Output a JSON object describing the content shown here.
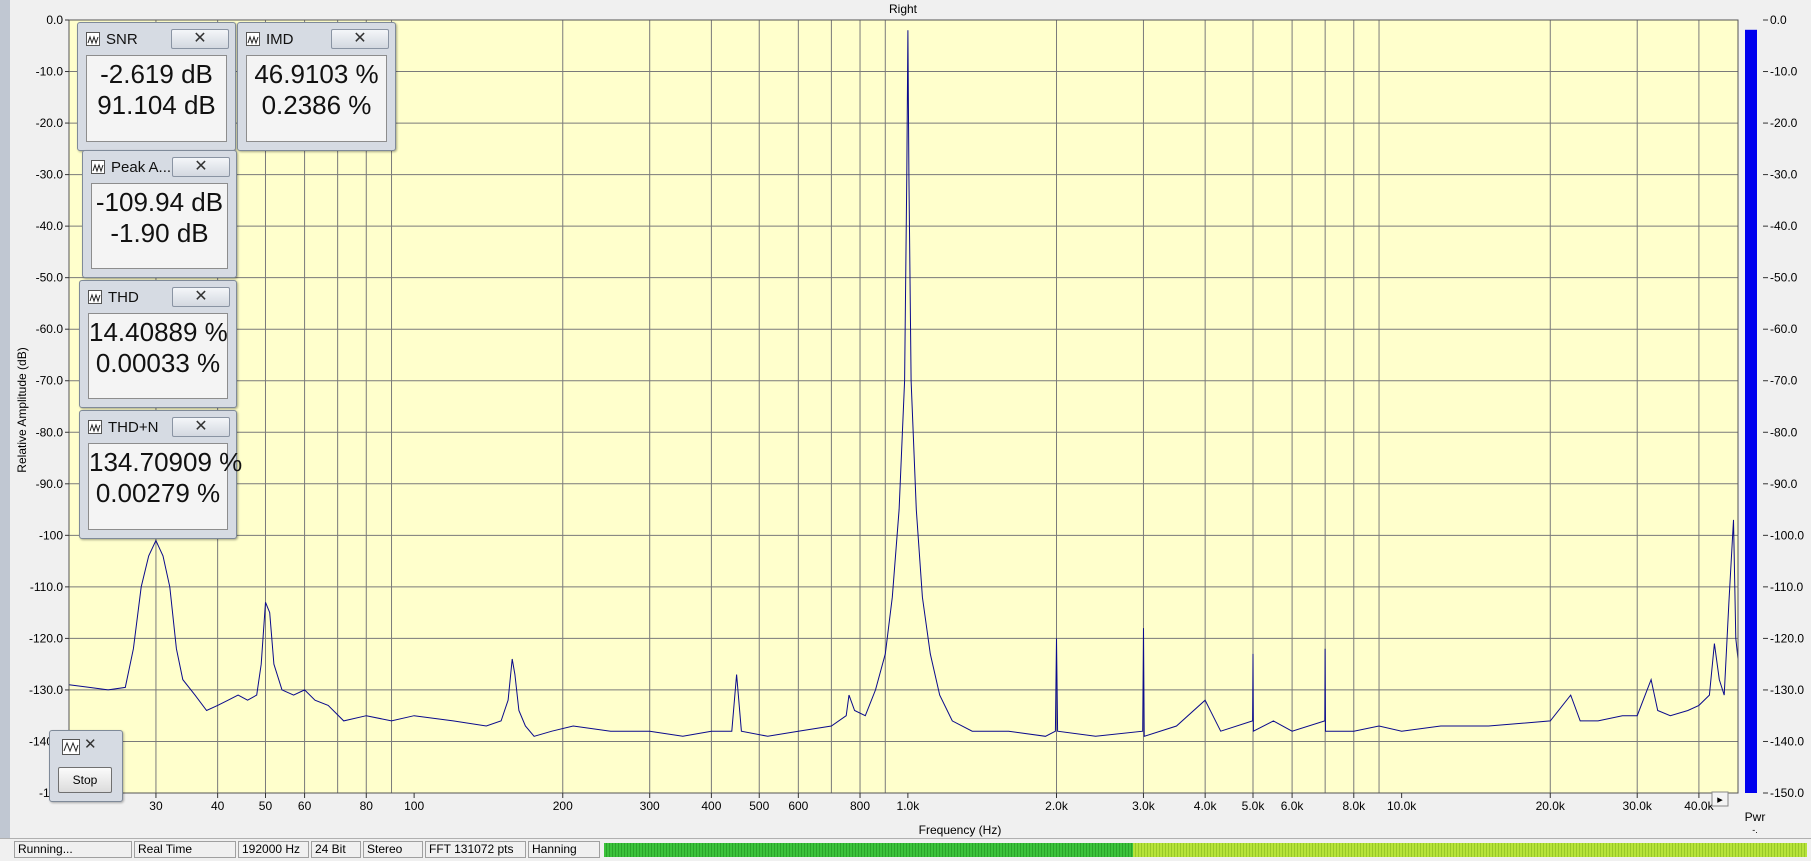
{
  "chart_data": {
    "type": "line",
    "title": "Right",
    "xlabel": "Frequency (Hz)",
    "ylabel": "Relative Amplitude (dB)",
    "x_scale": "log",
    "xlim": [
      20,
      48000
    ],
    "ylim": [
      -150,
      0
    ],
    "grid": true,
    "x_tick_labels": [
      "30",
      "40",
      "50",
      "60",
      "80",
      "100",
      "200",
      "300",
      "400",
      "500",
      "600",
      "800",
      "1.0k",
      "2.0k",
      "3.0k",
      "4.0k",
      "5.0k",
      "6.0k",
      "8.0k",
      "10.0k",
      "20.0k",
      "30.0k",
      "40.0k"
    ],
    "x_tick_values": [
      30,
      40,
      50,
      60,
      80,
      100,
      200,
      300,
      400,
      500,
      600,
      800,
      1000,
      2000,
      3000,
      4000,
      5000,
      6000,
      8000,
      10000,
      20000,
      30000,
      40000
    ],
    "y_tick_labels": [
      "0.0",
      "-10.0",
      "-20.0",
      "-30.0",
      "-40.0",
      "-50.0",
      "-60.0",
      "-70.0",
      "-80.0",
      "-90.0",
      "-100",
      "-110.0",
      "-120.0",
      "-130.0",
      "-140.0",
      "-150"
    ],
    "series": [
      {
        "color": "#0a0a8c",
        "points": [
          [
            20,
            -129
          ],
          [
            22,
            -129.5
          ],
          [
            24,
            -130
          ],
          [
            26,
            -129.5
          ],
          [
            27,
            -122
          ],
          [
            28,
            -110
          ],
          [
            29,
            -104
          ],
          [
            30,
            -101
          ],
          [
            31,
            -104
          ],
          [
            32,
            -110
          ],
          [
            33,
            -122
          ],
          [
            34,
            -128
          ],
          [
            36,
            -131
          ],
          [
            38,
            -134
          ],
          [
            40,
            -133
          ],
          [
            42,
            -132
          ],
          [
            44,
            -131
          ],
          [
            46,
            -132
          ],
          [
            48,
            -131
          ],
          [
            49,
            -125
          ],
          [
            50,
            -113
          ],
          [
            51,
            -115
          ],
          [
            52,
            -125
          ],
          [
            54,
            -130
          ],
          [
            57,
            -131
          ],
          [
            60,
            -130
          ],
          [
            63,
            -132
          ],
          [
            67,
            -133
          ],
          [
            72,
            -136
          ],
          [
            80,
            -135
          ],
          [
            90,
            -136
          ],
          [
            100,
            -135
          ],
          [
            120,
            -136
          ],
          [
            140,
            -137
          ],
          [
            150,
            -136
          ],
          [
            155,
            -132
          ],
          [
            158,
            -124
          ],
          [
            160,
            -127
          ],
          [
            163,
            -134
          ],
          [
            168,
            -137
          ],
          [
            175,
            -139
          ],
          [
            190,
            -138
          ],
          [
            210,
            -137
          ],
          [
            250,
            -138
          ],
          [
            300,
            -138
          ],
          [
            350,
            -139
          ],
          [
            400,
            -138
          ],
          [
            440,
            -138
          ],
          [
            450,
            -127
          ],
          [
            460,
            -138
          ],
          [
            520,
            -139
          ],
          [
            600,
            -138
          ],
          [
            700,
            -137
          ],
          [
            750,
            -135
          ],
          [
            760,
            -131
          ],
          [
            780,
            -134
          ],
          [
            820,
            -135
          ],
          [
            860,
            -130
          ],
          [
            900,
            -123
          ],
          [
            930,
            -112
          ],
          [
            960,
            -95
          ],
          [
            985,
            -70
          ],
          [
            995,
            -30
          ],
          [
            1000,
            -2
          ],
          [
            1005,
            -30
          ],
          [
            1015,
            -70
          ],
          [
            1040,
            -95
          ],
          [
            1070,
            -112
          ],
          [
            1110,
            -123
          ],
          [
            1160,
            -131
          ],
          [
            1230,
            -136
          ],
          [
            1350,
            -138
          ],
          [
            1600,
            -138
          ],
          [
            1900,
            -139
          ],
          [
            1990,
            -138
          ],
          [
            2000,
            -120
          ],
          [
            2010,
            -138
          ],
          [
            2400,
            -139
          ],
          [
            2990,
            -138
          ],
          [
            3000,
            -118
          ],
          [
            3010,
            -139
          ],
          [
            3500,
            -137
          ],
          [
            4000,
            -132
          ],
          [
            4300,
            -138
          ],
          [
            4990,
            -136
          ],
          [
            5000,
            -123
          ],
          [
            5010,
            -138
          ],
          [
            5500,
            -136
          ],
          [
            6000,
            -138
          ],
          [
            6990,
            -136
          ],
          [
            7000,
            -122
          ],
          [
            7010,
            -138
          ],
          [
            8000,
            -138
          ],
          [
            9000,
            -137
          ],
          [
            10000,
            -138
          ],
          [
            12000,
            -137
          ],
          [
            15000,
            -137
          ],
          [
            20000,
            -136
          ],
          [
            22000,
            -131
          ],
          [
            23000,
            -136
          ],
          [
            25000,
            -136
          ],
          [
            28000,
            -135
          ],
          [
            30000,
            -135
          ],
          [
            32000,
            -128
          ],
          [
            33000,
            -134
          ],
          [
            35000,
            -135
          ],
          [
            38000,
            -134
          ],
          [
            40000,
            -133
          ],
          [
            42000,
            -131
          ],
          [
            43000,
            -121
          ],
          [
            44000,
            -128
          ],
          [
            45000,
            -131
          ],
          [
            46000,
            -113
          ],
          [
            47000,
            -97
          ],
          [
            47500,
            -120
          ],
          [
            48000,
            -124
          ]
        ]
      }
    ],
    "right_meter": {
      "label": "Pwr",
      "value_db": -1.9,
      "tick_labels": [
        "0.0",
        "-10.0",
        "-20.0",
        "-30.0",
        "-40.0",
        "-50.0",
        "-60.0",
        "-70.0",
        "-80.0",
        "-90.0",
        "-100.0",
        "-110.0",
        "-120.0",
        "-130.0",
        "-140.0",
        "-150.0"
      ],
      "color": "#0000ee"
    }
  },
  "panels": {
    "snr": {
      "title": "SNR",
      "v1": "-2.619 dB",
      "v2": "91.104 dB"
    },
    "imd": {
      "title": "IMD",
      "v1": "46.9103 %",
      "v2": "0.2386 %"
    },
    "peak": {
      "title": "Peak A...",
      "v1": "-109.94 dB",
      "v2": "-1.90 dB"
    },
    "thd": {
      "title": "THD",
      "v1": "14.40889 %",
      "v2": "0.00033 %"
    },
    "thdn": {
      "title": "THD+N",
      "v1": "134.70909 %",
      "v2": "0.00279 %"
    }
  },
  "stop_button": {
    "label": "Stop"
  },
  "scroll_arrow": "▸",
  "statusbar": {
    "state": "Running...",
    "mode": "Real Time",
    "rate": "192000 Hz",
    "bits": "24 Bit",
    "channels": "Stereo",
    "fft": "FFT 131072 pts",
    "window": "Hanning",
    "meter_level": 0.44
  },
  "colors": {
    "plot_bg": "#ffffcc",
    "grid": "#7a7a7a",
    "trace": "#0a0a8c",
    "meter": "#0000ee"
  }
}
